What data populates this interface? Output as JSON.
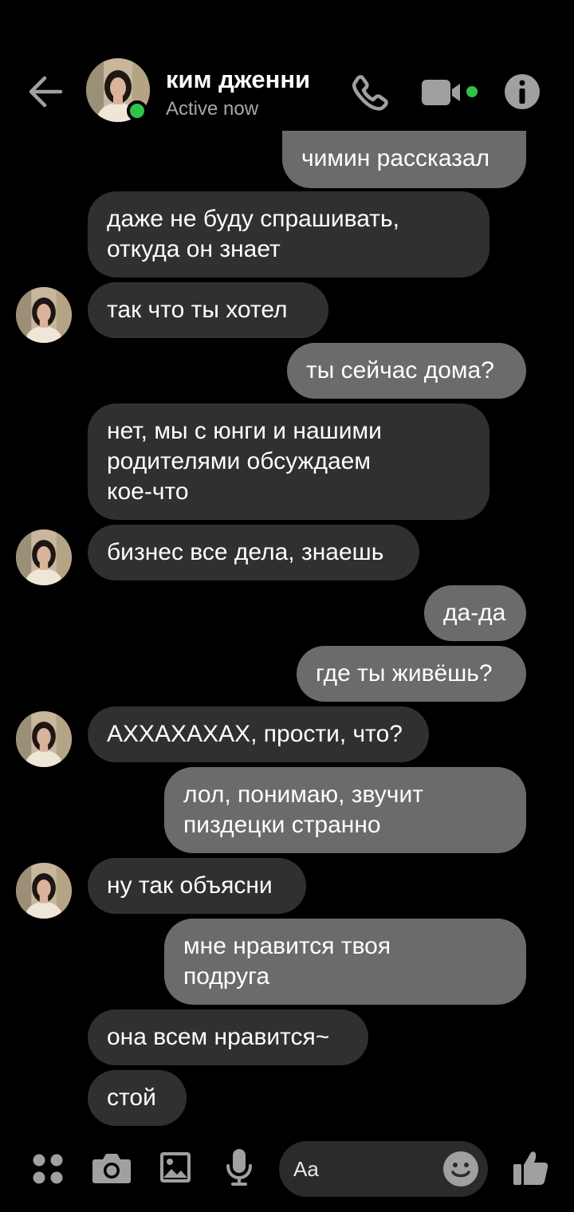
{
  "header": {
    "contact_name": "ким дженни",
    "status": "Active now"
  },
  "messages": [
    {
      "dir": "out",
      "text": "чимин рассказал"
    },
    {
      "dir": "in",
      "text": "даже не буду спрашивать,\nоткуда он знает"
    },
    {
      "dir": "in",
      "text": "так что ты хотел",
      "avatar": true
    },
    {
      "dir": "out",
      "text": "ты сейчас дома?"
    },
    {
      "dir": "in",
      "text": "нет, мы с юнги и нашими\nродителями обсуждаем\nкое-что"
    },
    {
      "dir": "in",
      "text": "бизнес все дела, знаешь",
      "avatar": true
    },
    {
      "dir": "out",
      "text": "да-да"
    },
    {
      "dir": "out",
      "text": "где ты живёшь?"
    },
    {
      "dir": "in",
      "text": "АХХАХАХАХ, прости, что?",
      "avatar": true
    },
    {
      "dir": "out",
      "text": "лол, понимаю, звучит\nпиздецки странно"
    },
    {
      "dir": "in",
      "text": "ну так объясни",
      "avatar": true
    },
    {
      "dir": "out",
      "text": "мне нравится твоя\nподруга"
    },
    {
      "dir": "in",
      "text": "она всем нравится~"
    },
    {
      "dir": "in",
      "text": "стой"
    }
  ],
  "composer": {
    "placeholder": "Aa"
  },
  "colors": {
    "background": "#000000",
    "incoming_bubble": "#303030",
    "outgoing_bubble": "#6b6b6b",
    "online": "#31c24c",
    "icon": "#a0a0a0"
  },
  "icons": [
    "back-arrow-icon",
    "phone-icon",
    "video-camera-icon",
    "info-icon",
    "apps-grid-icon",
    "camera-icon",
    "gallery-icon",
    "microphone-icon",
    "emoji-icon",
    "thumbs-up-icon"
  ]
}
